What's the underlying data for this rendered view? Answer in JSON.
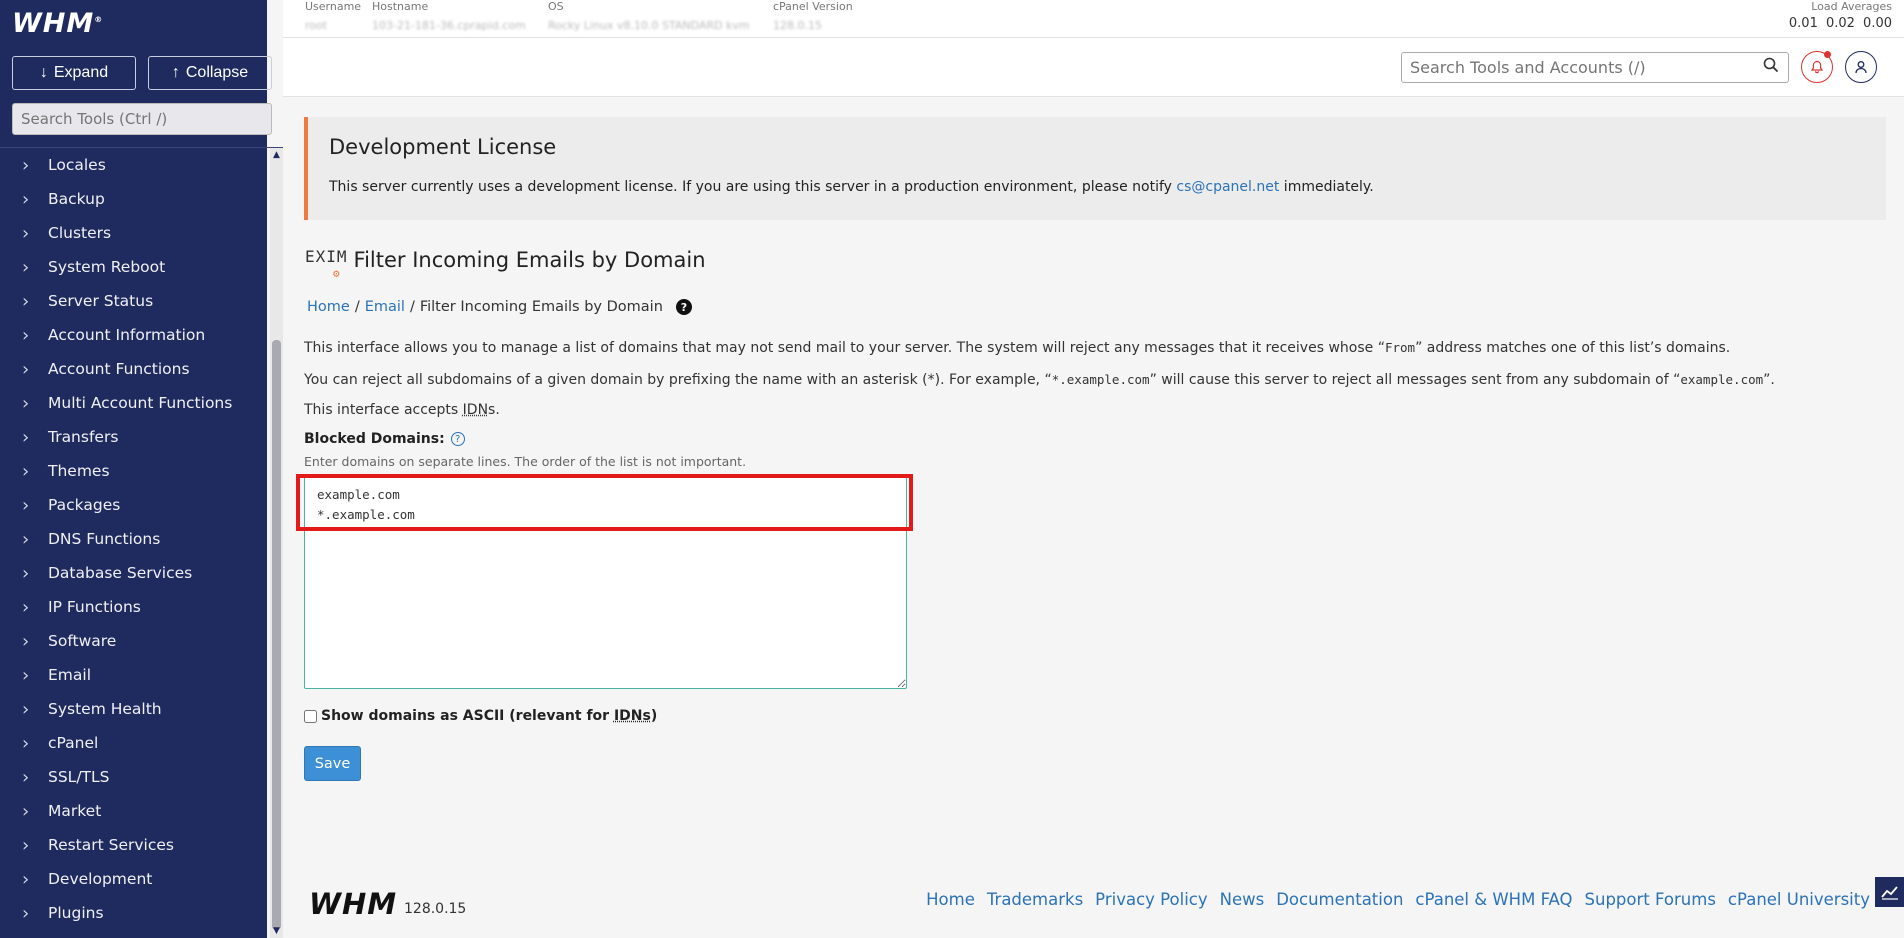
{
  "sidebar": {
    "logo": "WHM",
    "expand_label": "Expand",
    "collapse_label": "Collapse",
    "search_placeholder": "Search Tools (Ctrl /)",
    "items": [
      {
        "label": "Locales"
      },
      {
        "label": "Backup"
      },
      {
        "label": "Clusters"
      },
      {
        "label": "System Reboot"
      },
      {
        "label": "Server Status"
      },
      {
        "label": "Account Information"
      },
      {
        "label": "Account Functions"
      },
      {
        "label": "Multi Account Functions"
      },
      {
        "label": "Transfers"
      },
      {
        "label": "Themes"
      },
      {
        "label": "Packages"
      },
      {
        "label": "DNS Functions"
      },
      {
        "label": "Database Services"
      },
      {
        "label": "IP Functions"
      },
      {
        "label": "Software"
      },
      {
        "label": "Email"
      },
      {
        "label": "System Health"
      },
      {
        "label": "cPanel"
      },
      {
        "label": "SSL/TLS"
      },
      {
        "label": "Market"
      },
      {
        "label": "Restart Services"
      },
      {
        "label": "Development"
      },
      {
        "label": "Plugins"
      }
    ]
  },
  "topinfo": {
    "username_label": "Username",
    "username_value": "root",
    "hostname_label": "Hostname",
    "hostname_value": "103-21-181-36.cprapid.com",
    "os_label": "OS",
    "os_value": "Rocky Linux v8.10.0 STANDARD kvm",
    "version_label": "cPanel Version",
    "version_value": "128.0.15",
    "load_label": "Load Averages",
    "load_values": "0.01  0.02  0.00"
  },
  "header": {
    "search_placeholder": "Search Tools and Accounts (/)"
  },
  "license": {
    "title": "Development License",
    "text_before": "This server currently uses a development license. If you are using this server in a production environment, please notify ",
    "email": "cs@cpanel.net",
    "text_after": " immediately."
  },
  "page": {
    "exim_logo": "EXIM",
    "title": "Filter Incoming Emails by Domain",
    "breadcrumb": {
      "home": "Home",
      "sep": "/",
      "email": "Email",
      "current": "Filter Incoming Emails by Domain"
    },
    "para1_a": "This interface allows you to manage a list of domains that may not send mail to your server. The system will reject any messages that it receives whose “",
    "para1_code": "From",
    "para1_b": "” address matches one of this list’s domains.",
    "para2_a": "You can reject all subdomains of a given domain by prefixing the name with an asterisk (*). For example, “",
    "para2_code1": "*.example.com",
    "para2_b": "” will cause this server to reject all messages sent from any subdomain of “",
    "para2_code2": "example.com",
    "para2_c": "”.",
    "para3_a": "This interface accepts ",
    "para3_abbr": "IDN",
    "para3_b": "s.",
    "blocked_label": "Blocked Domains:",
    "blocked_hint": "Enter domains on separate lines. The order of the list is not important.",
    "domains_value": "example.com\n*.example.com",
    "ascii_label_a": "Show domains as ASCII (relevant for ",
    "ascii_abbr": "IDNs",
    "ascii_label_b": ")",
    "save_label": "Save"
  },
  "footer": {
    "logo": "WHM",
    "version": "128.0.15",
    "links": [
      "Home",
      "Trademarks",
      "Privacy Policy",
      "News",
      "Documentation",
      "cPanel & WHM FAQ",
      "Support Forums",
      "cPanel University"
    ]
  },
  "colors": {
    "sidebar_bg": "#1f2a5e",
    "accent_orange": "#f07a3e",
    "link_blue": "#2b73b8",
    "save_blue": "#3d8fd6",
    "highlight_red": "#e31a1a"
  }
}
